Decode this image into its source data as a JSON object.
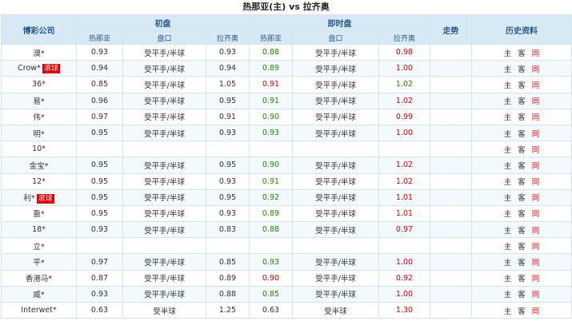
{
  "title": "热那亚(主) vs 拉齐奥",
  "header": {
    "company": "博彩公司",
    "initial": "初盘",
    "live": "即时盘",
    "trend": "走势",
    "history": "历史资料",
    "home": "热那亚",
    "line": "盘口",
    "away": "拉齐奥",
    "home2": "热那亚",
    "line2": "盘口",
    "away2": "拉齐奥"
  },
  "links": {
    "home": "主",
    "away": "客",
    "same": "同"
  },
  "rows": [
    {
      "company": "澳*",
      "tag": "",
      "i_home": "0.93",
      "i_line": "受平手/半球",
      "i_away": "0.93",
      "l_home": "0.88",
      "l_home_dir": "down",
      "l_line": "受平手/半球",
      "l_away": "0.98",
      "l_away_dir": "up"
    },
    {
      "company": "Crow*",
      "tag": "滚球",
      "i_home": "0.94",
      "i_line": "受平手/半球",
      "i_away": "0.94",
      "l_home": "0.89",
      "l_home_dir": "down",
      "l_line": "受平手/半球",
      "l_away": "1.00",
      "l_away_dir": "up"
    },
    {
      "company": "36*",
      "tag": "",
      "i_home": "0.85",
      "i_line": "受平手/半球",
      "i_away": "1.05",
      "l_home": "0.91",
      "l_home_dir": "up",
      "l_line": "受平手/半球",
      "l_away": "1.02",
      "l_away_dir": "down"
    },
    {
      "company": "易*",
      "tag": "",
      "i_home": "0.96",
      "i_line": "受平手/半球",
      "i_away": "0.95",
      "l_home": "0.91",
      "l_home_dir": "down",
      "l_line": "受平手/半球",
      "l_away": "1.02",
      "l_away_dir": "up"
    },
    {
      "company": "伟*",
      "tag": "",
      "i_home": "0.97",
      "i_line": "受平手/半球",
      "i_away": "0.91",
      "l_home": "0.90",
      "l_home_dir": "down",
      "l_line": "受平手/半球",
      "l_away": "0.99",
      "l_away_dir": "up"
    },
    {
      "company": "明*",
      "tag": "",
      "i_home": "0.95",
      "i_line": "受平手/半球",
      "i_away": "0.93",
      "l_home": "0.93",
      "l_home_dir": "down",
      "l_line": "受平手/半球",
      "l_away": "1.00",
      "l_away_dir": "up"
    },
    {
      "company": "10*",
      "tag": "",
      "i_home": "",
      "i_line": "",
      "i_away": "",
      "l_home": "",
      "l_home_dir": "",
      "l_line": "",
      "l_away": "",
      "l_away_dir": ""
    },
    {
      "company": "金宝*",
      "tag": "",
      "i_home": "0.95",
      "i_line": "受平手/半球",
      "i_away": "0.95",
      "l_home": "0.90",
      "l_home_dir": "down",
      "l_line": "受平手/半球",
      "l_away": "1.02",
      "l_away_dir": "up"
    },
    {
      "company": "12*",
      "tag": "",
      "i_home": "0.95",
      "i_line": "受平手/半球",
      "i_away": "0.93",
      "l_home": "0.91",
      "l_home_dir": "down",
      "l_line": "受平手/半球",
      "l_away": "1.02",
      "l_away_dir": "up"
    },
    {
      "company": "利*",
      "tag": "滚球",
      "i_home": "0.95",
      "i_line": "受平手/半球",
      "i_away": "0.95",
      "l_home": "0.92",
      "l_home_dir": "down",
      "l_line": "受平手/半球",
      "l_away": "1.01",
      "l_away_dir": "up"
    },
    {
      "company": "盈*",
      "tag": "",
      "i_home": "0.95",
      "i_line": "受平手/半球",
      "i_away": "0.93",
      "l_home": "0.89",
      "l_home_dir": "down",
      "l_line": "受平手/半球",
      "l_away": "1.01",
      "l_away_dir": "up"
    },
    {
      "company": "18*",
      "tag": "",
      "i_home": "0.93",
      "i_line": "受平手/半球",
      "i_away": "0.83",
      "l_home": "0.88",
      "l_home_dir": "down",
      "l_line": "受平手/半球",
      "l_away": "0.97",
      "l_away_dir": "up"
    },
    {
      "company": "立*",
      "tag": "",
      "i_home": "",
      "i_line": "",
      "i_away": "",
      "l_home": "",
      "l_home_dir": "",
      "l_line": "",
      "l_away": "",
      "l_away_dir": ""
    },
    {
      "company": "平*",
      "tag": "",
      "i_home": "0.97",
      "i_line": "受平手/半球",
      "i_away": "0.85",
      "l_home": "0.93",
      "l_home_dir": "down",
      "l_line": "受平手/半球",
      "l_away": "1.00",
      "l_away_dir": "up"
    },
    {
      "company": "香港马*",
      "tag": "",
      "i_home": "0.87",
      "i_line": "受平手/半球",
      "i_away": "0.89",
      "l_home": "0.90",
      "l_home_dir": "up",
      "l_line": "受平手/半球",
      "l_away": "0.92",
      "l_away_dir": "up"
    },
    {
      "company": "威*",
      "tag": "",
      "i_home": "0.93",
      "i_line": "受平手/半球",
      "i_away": "0.88",
      "l_home": "0.85",
      "l_home_dir": "down",
      "l_line": "受平手/半球",
      "l_away": "1.00",
      "l_away_dir": "up"
    },
    {
      "company": "Interwet*",
      "tag": "",
      "i_home": "0.63",
      "i_line": "受半球",
      "i_away": "1.25",
      "l_home": "0.63",
      "l_home_dir": "",
      "l_line": "受半球",
      "l_away": "1.30",
      "l_away_dir": "up"
    }
  ]
}
